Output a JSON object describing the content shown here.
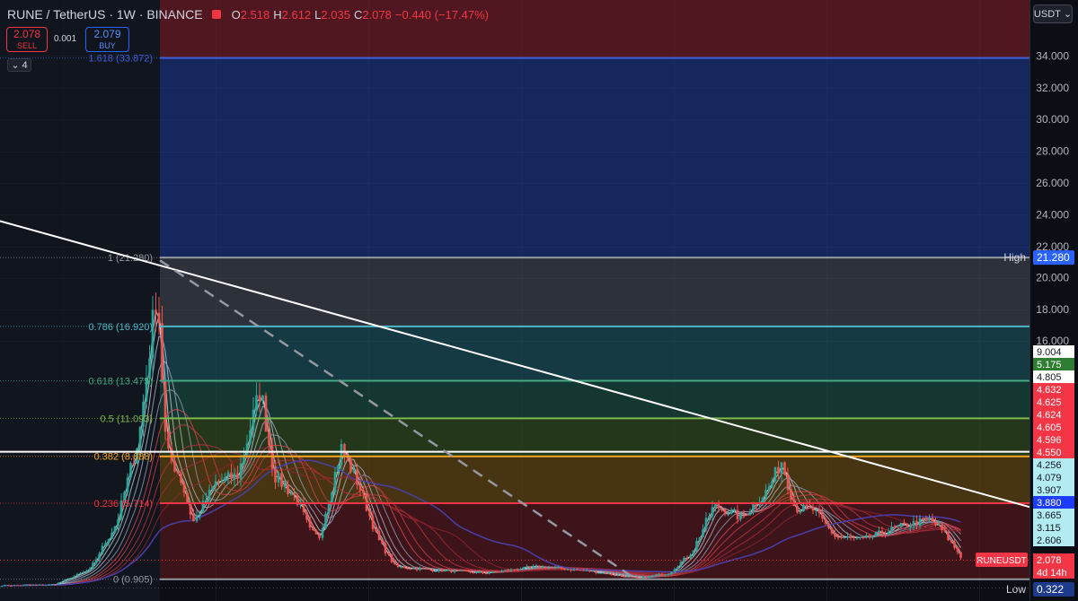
{
  "header": {
    "symbol": "RUNE / TetherUS · 1W · BINANCE",
    "open_label": "O",
    "open": "2.518",
    "high_label": "H",
    "high": "2.612",
    "low_label": "L",
    "low": "2.035",
    "close_label": "C",
    "close": "2.078",
    "change": "−0.440 (−17.47%)"
  },
  "trade": {
    "sell_price": "2.078",
    "sell_label": "SELL",
    "spread": "0.001",
    "buy_price": "2.079",
    "buy_label": "BUY"
  },
  "indicators_collapse": {
    "count": "4",
    "icon": "chevron-down-icon"
  },
  "currency_button": {
    "label": "USDT",
    "icon": "chevron-down-icon"
  },
  "colors": {
    "background": "#0b0e15",
    "up": "#26a69a",
    "down": "#ef5350",
    "trendline": "#ffffff",
    "dashed_trendline": "#9598a1"
  },
  "chart_data": {
    "type": "candlestick",
    "symbol": "RUNEUSDT",
    "interval": "1W",
    "y_axis": {
      "range": [
        0,
        36
      ],
      "ticks": [
        "34.000",
        "32.000",
        "30.000",
        "28.000",
        "26.000",
        "24.000",
        "22.000",
        "20.000",
        "18.000",
        "16.000"
      ]
    },
    "fib_levels": [
      {
        "ratio": "1.618",
        "price": 33.872,
        "label": "1.618 (33.872)",
        "color": "#3f5fd8"
      },
      {
        "ratio": "1",
        "price": 21.28,
        "label": "1 (21.280)",
        "color": "#9598a1"
      },
      {
        "ratio": "0.786",
        "price": 16.92,
        "label": "0.786 (16.920)",
        "color": "#4fb8c8"
      },
      {
        "ratio": "0.618",
        "price": 13.475,
        "label": "0.618 (13.475)",
        "color": "#44a882"
      },
      {
        "ratio": "0.5",
        "price": 11.093,
        "label": "0.5 (11.093)",
        "color": "#7fb84a"
      },
      {
        "ratio": "0.382",
        "price": 8.688,
        "label": "0.382 (8.688)",
        "color": "#f5a623"
      },
      {
        "ratio": "0.236",
        "price": 5.714,
        "label": "0.236 (5.714)",
        "color": "#f23645"
      },
      {
        "ratio": "0",
        "price": 0.905,
        "label": "0 (0.905)",
        "color": "#9598a1"
      }
    ],
    "fib_zone_colors": [
      "#8b1f2a",
      "#1f3d99",
      "#4a4e5a",
      "#1f5f6a",
      "#1f5a4a",
      "#3a5a20",
      "#7a5410",
      "#6a1a20"
    ],
    "horizontal_line_price": 8.98,
    "trendline": {
      "start_price": 23.6,
      "end_price": 5.48,
      "color": "#ffffff"
    },
    "dashed_trendline": {
      "start_price": 21.1,
      "end_price": 0.905
    },
    "price_axis_labels": [
      {
        "text": "9.004",
        "bg": "#ffffff",
        "fg": "#131722"
      },
      {
        "text": "5.175",
        "bg": "#2e7d32",
        "fg": "#ffffff"
      },
      {
        "text": "4.805",
        "bg": "#ffffff",
        "fg": "#131722"
      },
      {
        "text": "4.632",
        "bg": "#f23645",
        "fg": "#ffffff"
      },
      {
        "text": "4.625",
        "bg": "#f23645",
        "fg": "#ffffff"
      },
      {
        "text": "4.624",
        "bg": "#f23645",
        "fg": "#ffffff"
      },
      {
        "text": "4.605",
        "bg": "#f23645",
        "fg": "#ffffff"
      },
      {
        "text": "4.596",
        "bg": "#f23645",
        "fg": "#ffffff"
      },
      {
        "text": "4.550",
        "bg": "#f23645",
        "fg": "#ffffff"
      },
      {
        "text": "4.256",
        "bg": "#b2ebf2",
        "fg": "#131722"
      },
      {
        "text": "4.079",
        "bg": "#b2ebf2",
        "fg": "#131722"
      },
      {
        "text": "3.907",
        "bg": "#b2ebf2",
        "fg": "#131722"
      },
      {
        "text": "3.880",
        "bg": "#1e3cff",
        "fg": "#ffffff"
      },
      {
        "text": "3.665",
        "bg": "#b2ebf2",
        "fg": "#131722"
      },
      {
        "text": "3.115",
        "bg": "#b2ebf2",
        "fg": "#131722"
      },
      {
        "text": "2.606",
        "bg": "#b2ebf2",
        "fg": "#131722"
      },
      {
        "text": "2.078",
        "bg": "#f23645",
        "fg": "#ffffff"
      }
    ],
    "current_price": {
      "symbol_label": "RUNEUSDT",
      "value": "2.078",
      "countdown": "4d 14h"
    },
    "high_marker": {
      "label": "High",
      "value": "21.280"
    },
    "low_marker": {
      "label": "Low",
      "value": "0.322"
    }
  }
}
